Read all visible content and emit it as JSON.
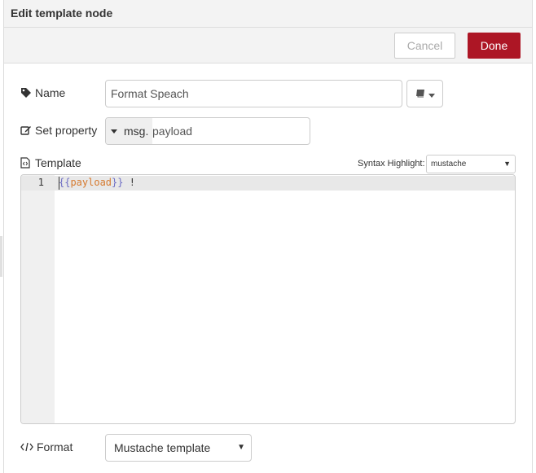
{
  "dialog": {
    "title": "Edit template node",
    "cancel_label": "Cancel",
    "done_label": "Done"
  },
  "form": {
    "name": {
      "label": "Name",
      "value": "Format Speach",
      "icon": "tag-icon",
      "library_icon": "book-icon"
    },
    "set_property": {
      "label": "Set property",
      "type": "msg.",
      "value": "payload",
      "icon": "edit-icon"
    },
    "template": {
      "label": "Template",
      "icon": "file-code-icon",
      "syntax_label": "Syntax Highlight:",
      "syntax_value": "mustache",
      "line_number": "1",
      "code_open": "{{",
      "code_var": "payload",
      "code_close": "}}",
      "code_rest": " !"
    },
    "format": {
      "label": "Format",
      "value": "Mustache template",
      "icon": "code-icon"
    }
  },
  "colors": {
    "done_button": "#ad1625",
    "mustache_brace": "#6e6ec4",
    "mustache_var": "#d67a2f"
  }
}
